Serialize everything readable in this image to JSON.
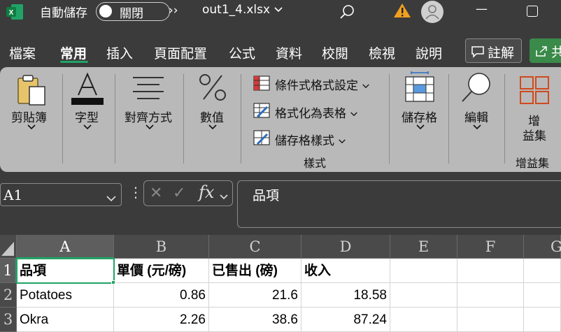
{
  "titlebar": {
    "autosave_label": "自動儲存",
    "toggle_label": "關閉",
    "more_glyph": "››",
    "filename": "out1_4.xlsx",
    "filename_chevron": "⌵",
    "minimize_glyph": "—"
  },
  "menu": {
    "items": [
      "檔案",
      "常用",
      "插入",
      "頁面配置",
      "公式",
      "資料",
      "校閱",
      "檢視",
      "說明"
    ],
    "comment_label": "註解",
    "share_label": "共"
  },
  "ribbon": {
    "clipboard_label": "剪貼簿",
    "font_label": "字型",
    "align_label": "對齊方式",
    "number_label": "數值",
    "cond_format": "條件式格式設定",
    "format_table": "格式化為表格",
    "cell_styles": "儲存格樣式",
    "styles_group": "樣式",
    "cells_label": "儲存格",
    "edit_label": "編輯",
    "addins_line1": "增",
    "addins_line2": "益集",
    "addins_group": "增益集",
    "chevron": "⌄"
  },
  "formula_bar": {
    "name_box": "A1",
    "dots": "⋮",
    "cancel": "✕",
    "enter": "✓",
    "fx": "fx",
    "content": "品項"
  },
  "sheet": {
    "columns": [
      "A",
      "B",
      "C",
      "D",
      "E",
      "F",
      "G"
    ],
    "rows": [
      "1",
      "2",
      "3"
    ],
    "cells": [
      [
        "品項",
        "單價 (元/磅)",
        "已售出 (磅)",
        "收入"
      ],
      [
        "Potatoes",
        "0.86",
        "21.6",
        "18.58"
      ],
      [
        "Okra",
        "2.26",
        "38.6",
        "87.24"
      ]
    ]
  },
  "colors": {
    "excel_green": "#21a366",
    "warning": "#f0a020"
  }
}
